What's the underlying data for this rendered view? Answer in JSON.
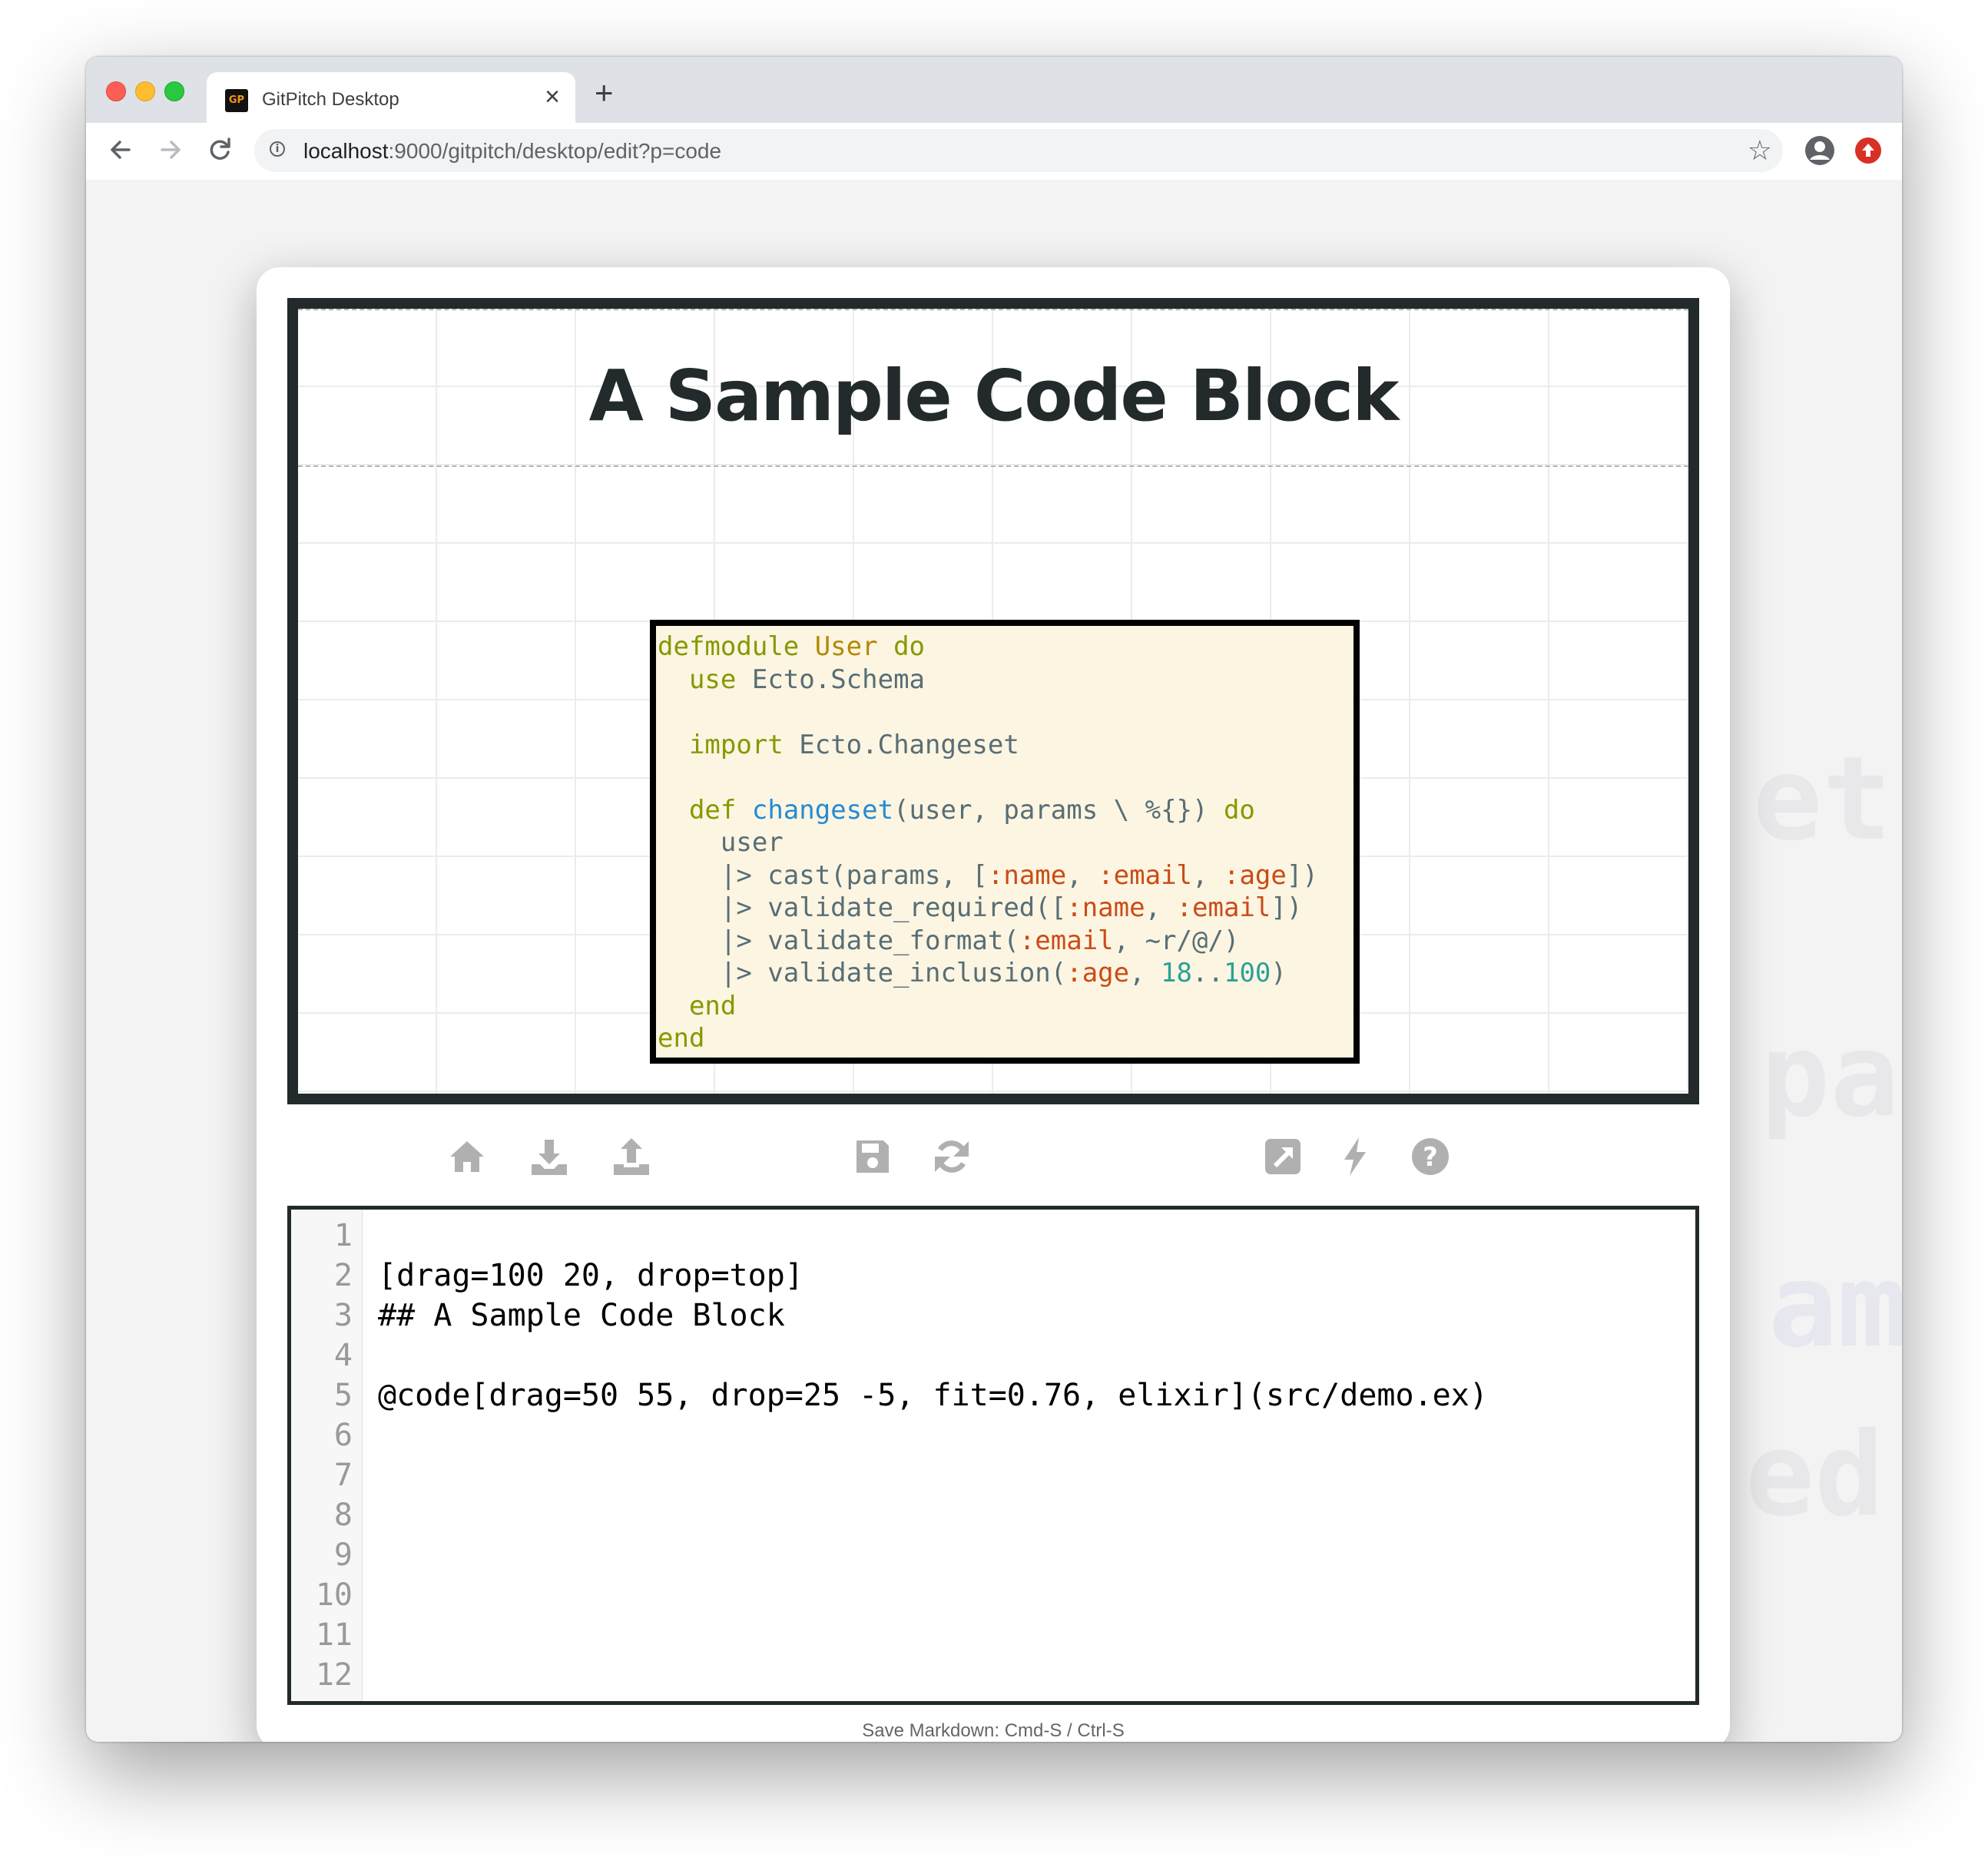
{
  "browser": {
    "tab_title": "GitPitch Desktop",
    "favicon_text": "GP",
    "url_host": "localhost",
    "url_rest": ":9000/gitpitch/desktop/edit?p=code"
  },
  "slide": {
    "title": "A Sample Code Block",
    "code_language": "elixir",
    "code_lines": [
      [
        {
          "t": "defmodule ",
          "c": "kw"
        },
        {
          "t": "User",
          "c": "ty"
        },
        {
          "t": " do",
          "c": "kw"
        }
      ],
      [
        {
          "t": "  "
        },
        {
          "t": "use",
          "c": "kw"
        },
        {
          "t": " Ecto.Schema"
        }
      ],
      [],
      [
        {
          "t": "  "
        },
        {
          "t": "import",
          "c": "kw"
        },
        {
          "t": " Ecto.Changeset"
        }
      ],
      [],
      [
        {
          "t": "  "
        },
        {
          "t": "def ",
          "c": "kw"
        },
        {
          "t": "changeset",
          "c": "fn"
        },
        {
          "t": "(user, params \\ %{}) "
        },
        {
          "t": "do",
          "c": "kw"
        }
      ],
      [
        {
          "t": "    user"
        }
      ],
      [
        {
          "t": "    |> cast(params, ["
        },
        {
          "t": ":name",
          "c": "at"
        },
        {
          "t": ", "
        },
        {
          "t": ":email",
          "c": "at"
        },
        {
          "t": ", "
        },
        {
          "t": ":age",
          "c": "at"
        },
        {
          "t": "])"
        }
      ],
      [
        {
          "t": "    |> validate_required(["
        },
        {
          "t": ":name",
          "c": "at"
        },
        {
          "t": ", "
        },
        {
          "t": ":email",
          "c": "at"
        },
        {
          "t": "])"
        }
      ],
      [
        {
          "t": "    |> validate_format("
        },
        {
          "t": ":email",
          "c": "at"
        },
        {
          "t": ", ~r/@/)"
        }
      ],
      [
        {
          "t": "    |> validate_inclusion("
        },
        {
          "t": ":age",
          "c": "at"
        },
        {
          "t": ", "
        },
        {
          "t": "18",
          "c": "nm"
        },
        {
          "t": ".."
        },
        {
          "t": "100",
          "c": "nm"
        },
        {
          "t": ")"
        }
      ],
      [
        {
          "t": "  "
        },
        {
          "t": "end",
          "c": "kw"
        }
      ],
      [
        {
          "t": "end",
          "c": "kw"
        }
      ]
    ]
  },
  "toolbar": {
    "icons": [
      "home-icon",
      "download-icon",
      "upload-icon",
      "save-icon",
      "refresh-icon",
      "external-link-icon",
      "bolt-icon",
      "help-icon"
    ]
  },
  "editor": {
    "line_numbers": [
      "1",
      "2",
      "3",
      "4",
      "5",
      "6",
      "7",
      "8",
      "9",
      "10",
      "11",
      "12"
    ],
    "lines": [
      "",
      "[drag=100 20, drop=top]",
      "## A Sample Code Block",
      "",
      "@code[drag=50 55, drop=25 -5, fit=0.76, elixir](src/demo.ex)",
      "",
      "",
      "",
      "",
      "",
      "",
      ""
    ]
  },
  "footer": {
    "hint": "Save Markdown: Cmd-S / Ctrl-S"
  },
  "background_text": [
    "et",
    "pa",
    "am",
    "ed("
  ],
  "colors": {
    "slide_border": "#232a2b",
    "code_background": "#fcf5e2",
    "keyword": "#859900",
    "type": "#b58900",
    "function": "#268bd2",
    "atom": "#cb4b16",
    "number": "#2aa198",
    "toolbar_icon": "#b0b0b0"
  }
}
